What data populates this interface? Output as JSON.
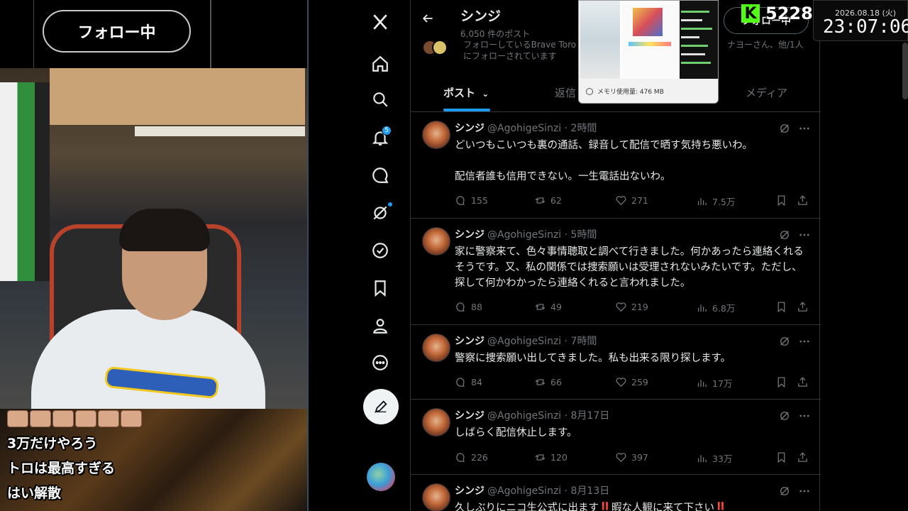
{
  "stream": {
    "follow_pill": "フォロー中",
    "chat": [
      "3万だけやろう",
      "トロは最高すぎる",
      "はい解散"
    ],
    "kick_count": "5228",
    "date": "2026.08.18 (火)",
    "time": "23:07:06"
  },
  "popup": {
    "memory": "メモリ使用量: 476 MB"
  },
  "profile": {
    "name": "シンジ",
    "post_count": "6,050 件のポスト",
    "followed_by_line1": "フォローしているBrave Toro",
    "followed_by_line2": "にフォローされています",
    "followed_by_right": "ナヨーさん、他/1人",
    "follow_button": "フォロー中"
  },
  "tabs": [
    "ポスト",
    "返信",
    "メディア"
  ],
  "nav": {
    "notification_badge": "5"
  },
  "tweets": [
    {
      "name": "シンジ",
      "handle": "@AgohigeSinzi · 2時間",
      "text": "どいつもこいつも裏の通話、録音して配信で晒す気持ち悪いわ。\n\n配信者誰も信用できない。一生電話出ないわ。",
      "replies": "155",
      "reposts": "62",
      "likes": "271",
      "views": "7.5万"
    },
    {
      "name": "シンジ",
      "handle": "@AgohigeSinzi · 5時間",
      "text": "家に警察来て、色々事情聴取と調べて行きました。何かあったら連絡くれるそうです。又、私の関係では捜索願いは受理されないみたいです。ただし、探して何かわかったら連絡くれると言われました。",
      "replies": "88",
      "reposts": "49",
      "likes": "219",
      "views": "6.8万"
    },
    {
      "name": "シンジ",
      "handle": "@AgohigeSinzi · 7時間",
      "text": "警察に捜索願い出してきました。私も出来る限り探します。",
      "replies": "84",
      "reposts": "66",
      "likes": "259",
      "views": "17万"
    },
    {
      "name": "シンジ",
      "handle": "@AgohigeSinzi · 8月17日",
      "text": "しばらく配信休止します。",
      "replies": "226",
      "reposts": "120",
      "likes": "397",
      "views": "33万"
    },
    {
      "name": "シンジ",
      "handle": "@AgohigeSinzi · 8月13日",
      "text": "久しぶりにニコ生公式に出ます‼️暇な人観に来て下さい‼️"
    }
  ],
  "colors": {
    "accent": "#1d9bf0",
    "kick_green": "#53fc18",
    "text_primary": "#e7e9ea",
    "text_secondary": "#71767b"
  }
}
